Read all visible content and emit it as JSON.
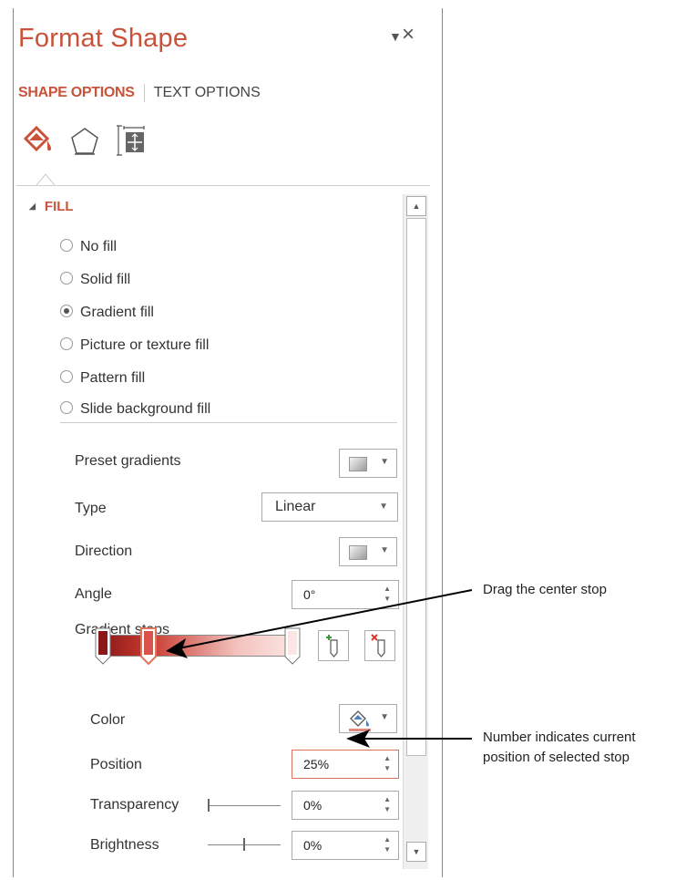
{
  "pane": {
    "title": "Format Shape",
    "pin_icon": "dropdown-triangle-icon",
    "close_label": "×",
    "tabs": [
      {
        "label": "SHAPE OPTIONS",
        "active": true
      },
      {
        "label": "TEXT OPTIONS",
        "active": false
      }
    ],
    "icons": [
      "fill-bucket-icon",
      "pentagon-icon",
      "size-properties-icon"
    ]
  },
  "fill": {
    "header": "FILL",
    "options": [
      {
        "label": "No fill",
        "checked": false
      },
      {
        "label": "Solid fill",
        "checked": false
      },
      {
        "label": "Gradient fill",
        "checked": true
      },
      {
        "label": "Picture or texture fill",
        "checked": false
      },
      {
        "label": "Pattern fill",
        "checked": false
      },
      {
        "label": "Slide background fill",
        "checked": false
      }
    ],
    "preset_gradients_label": "Preset gradients",
    "type_label": "Type",
    "type_value": "Linear",
    "direction_label": "Direction",
    "angle_label": "Angle",
    "angle_value": "0°",
    "gradient_stops_label": "Gradient stops",
    "stops": [
      0,
      25,
      100
    ],
    "selected_stop": 1,
    "color_label": "Color",
    "position_label": "Position",
    "position_value": "25%",
    "transparency_label": "Transparency",
    "transparency_value": "0%",
    "transparency_level": 0,
    "brightness_label": "Brightness",
    "brightness_value": "0%",
    "brightness_level": 0.5
  },
  "callouts": {
    "drag": "Drag the center stop",
    "position_line1": "Number indicates current",
    "position_line2": "position of selected stop"
  },
  "colors": {
    "accent": "#c8533a",
    "gradient_dark": "#8a1818",
    "gradient_light": "#fbe6e3"
  }
}
